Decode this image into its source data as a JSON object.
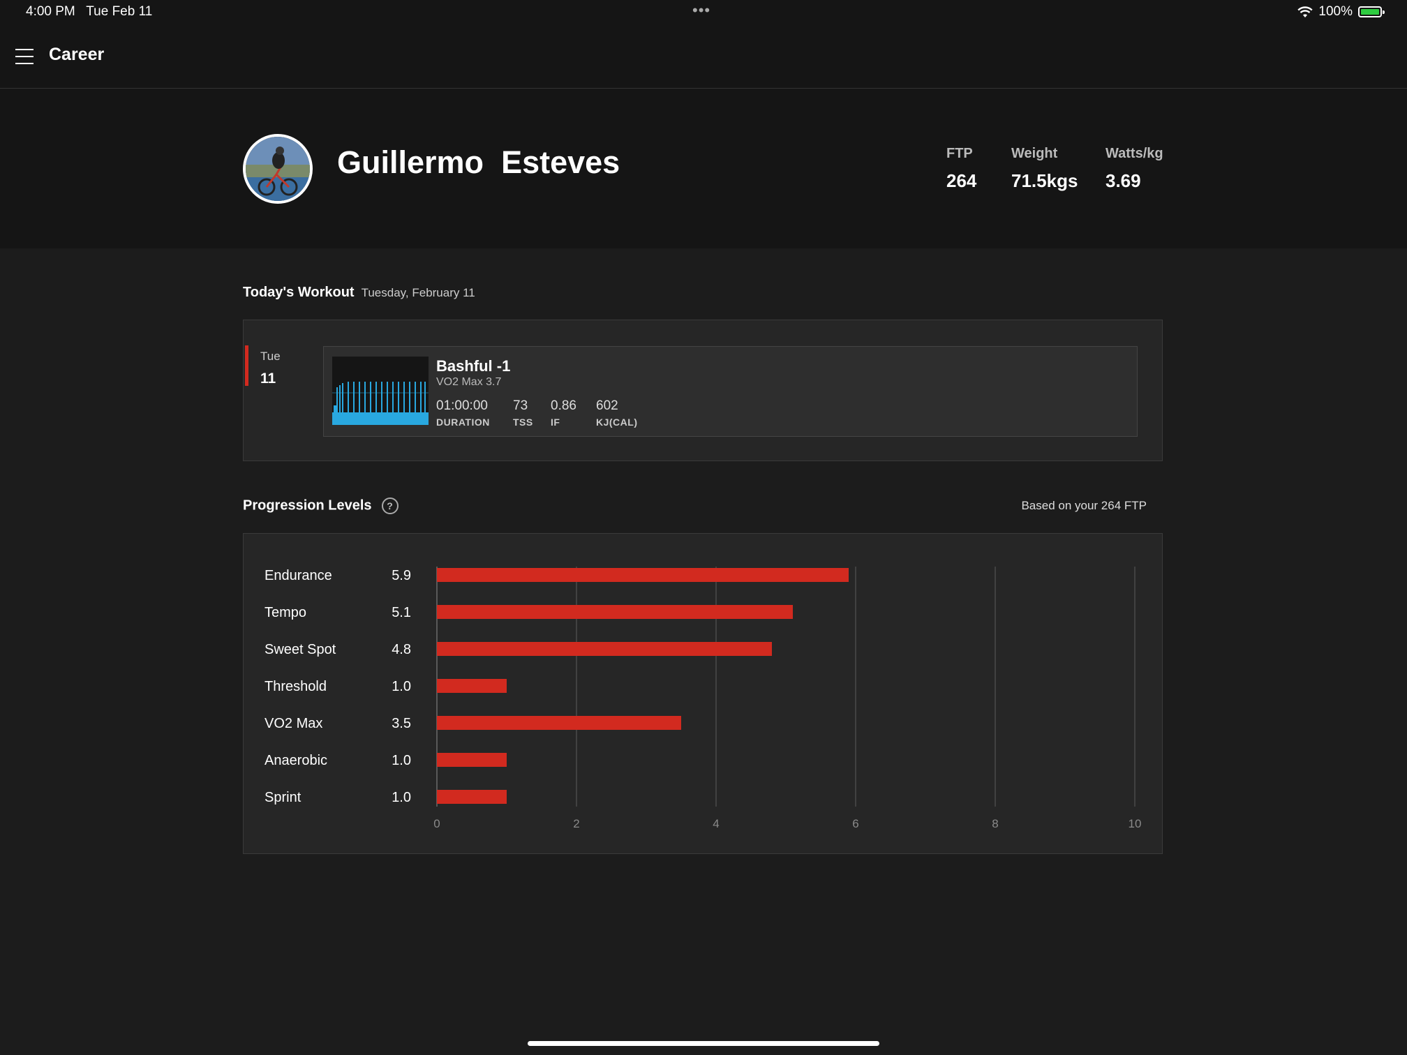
{
  "status_bar": {
    "time": "4:00 PM",
    "date": "Tue Feb 11",
    "battery": "100%"
  },
  "nav": {
    "title": "Career",
    "menu_icon": "hamburger-icon"
  },
  "profile": {
    "first_name": "Guillermo",
    "last_name": "Esteves",
    "stats": [
      {
        "label": "FTP",
        "value": "264"
      },
      {
        "label": "Weight",
        "value": "71.5kgs"
      },
      {
        "label": "Watts/kg",
        "value": "3.69"
      }
    ]
  },
  "today": {
    "heading": "Today's Workout",
    "date": "Tuesday, February 11",
    "day_name": "Tue",
    "day_num": "11",
    "workout": {
      "title": "Bashful -1",
      "subtitle": "VO2 Max 3.7",
      "metrics": [
        {
          "value": "01:00:00",
          "label": "DURATION"
        },
        {
          "value": "73",
          "label": "TSS"
        },
        {
          "value": "0.86",
          "label": "IF"
        },
        {
          "value": "602",
          "label": "KJ(CAL)"
        }
      ]
    }
  },
  "progression": {
    "heading": "Progression Levels",
    "help_icon": "question-icon",
    "based_on": "Based on your 264 FTP"
  },
  "colors": {
    "accent_red": "#d22a1f",
    "graph_blue": "#29a8e0"
  },
  "chart_data": {
    "type": "bar",
    "orientation": "horizontal",
    "categories": [
      "Endurance",
      "Tempo",
      "Sweet Spot",
      "Threshold",
      "VO2 Max",
      "Anaerobic",
      "Sprint"
    ],
    "values": [
      5.9,
      5.1,
      4.8,
      1.0,
      3.5,
      1.0,
      1.0
    ],
    "value_labels": [
      "5.9",
      "5.1",
      "4.8",
      "1.0",
      "3.5",
      "1.0",
      "1.0"
    ],
    "xlim": [
      0,
      10
    ],
    "xticks": [
      0,
      2,
      4,
      6,
      8,
      10
    ],
    "grid": true,
    "title": "",
    "xlabel": "",
    "ylabel": ""
  }
}
